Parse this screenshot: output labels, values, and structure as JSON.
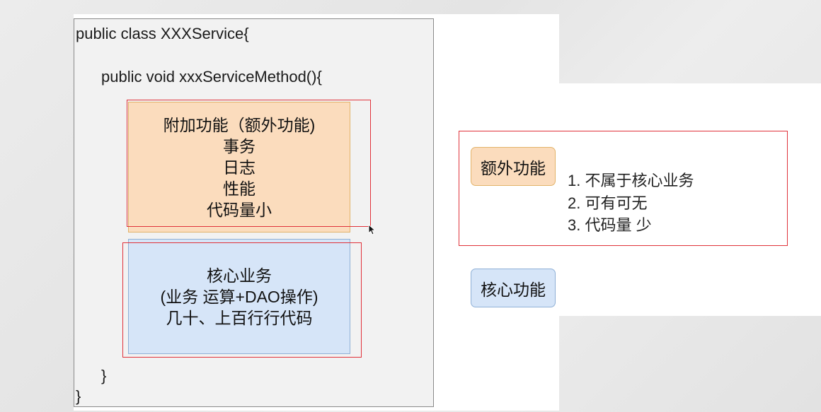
{
  "code": {
    "class_line": "public class XXXService{",
    "method_line": "public void xxxServiceMethod(){",
    "method_close": "}",
    "class_close": "}"
  },
  "additional_box": {
    "lines": [
      "附加功能（额外功能)",
      "事务",
      "日志",
      "性能",
      "代码量小"
    ]
  },
  "core_box": {
    "lines": [
      "核心业务",
      "(业务 运算+DAO操作)",
      "几十、上百行行代码"
    ]
  },
  "right_panel": {
    "extra_label": "额外功能",
    "extra_points": [
      "1. 不属于核心业务",
      "2. 可有可无",
      "3. 代码量 少"
    ],
    "core_label": "核心功能"
  },
  "colors": {
    "orange_fill": "#fbdcbd",
    "blue_fill": "#d6e5f8",
    "red_frame": "#e0323a"
  }
}
